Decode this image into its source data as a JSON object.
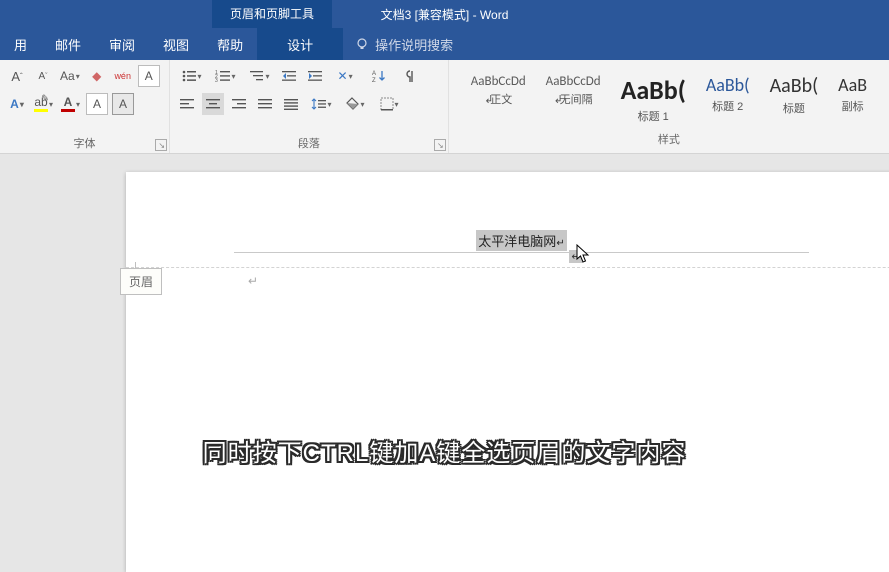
{
  "titlebar": {
    "tool_tab": "页眉和页脚工具",
    "title": "文档3 [兼容模式] - Word"
  },
  "tabs": {
    "t1": "用",
    "t2": "邮件",
    "t3": "审阅",
    "t4": "视图",
    "t5": "帮助",
    "t6": "设计",
    "tell_me": "操作说明搜索"
  },
  "ribbon": {
    "font_group_label": "字体",
    "para_group_label": "段落",
    "styles_group_label": "样式"
  },
  "styles": {
    "s1_preview": "AaBbCcDd",
    "s1_name": "正文",
    "s2_preview": "AaBbCcDd",
    "s2_name": "无间隔",
    "s3_preview": "AaBb(",
    "s3_name": "标题 1",
    "s4_preview": "AaBb(",
    "s4_name": "标题 2",
    "s5_preview": "AaBb(",
    "s5_name": "标题",
    "s6_preview": "AaB",
    "s6_name": "副标"
  },
  "document": {
    "header_text": "太平洋电脑网",
    "header_label": "页眉",
    "para_mark": "↵"
  },
  "subtitle": "同时按下CTRL键加A键全选页眉的文字内容"
}
